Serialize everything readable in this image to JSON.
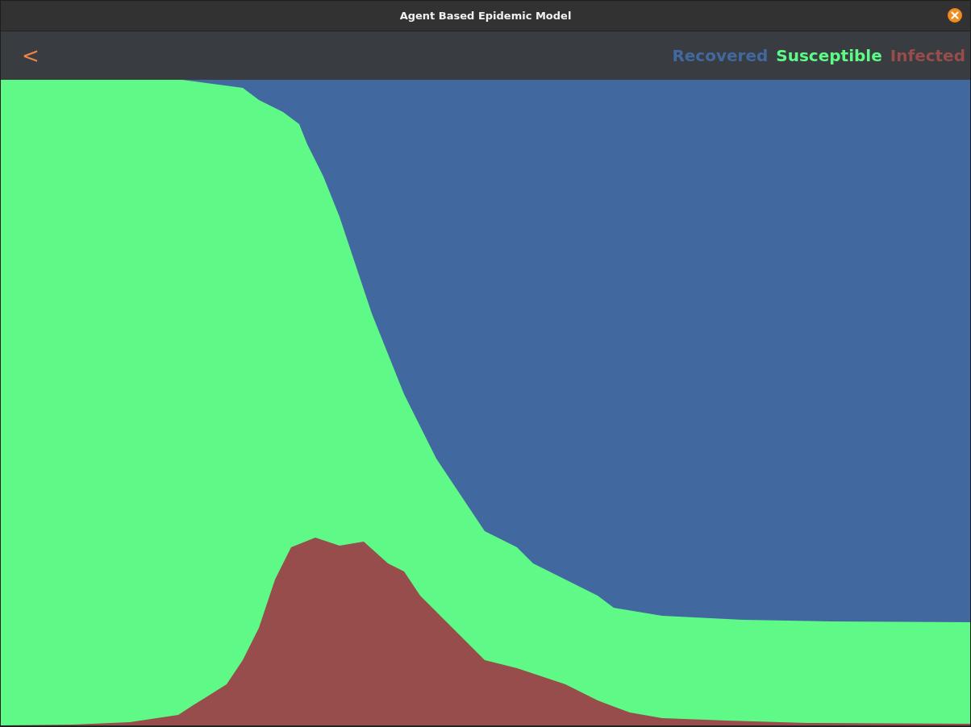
{
  "window": {
    "title": "Agent Based Epidemic Model"
  },
  "toolbar": {
    "back_button": "<"
  },
  "legend": [
    {
      "label": "Recovered",
      "color": "#4169a0"
    },
    {
      "label": "Susceptible",
      "color": "#5ff987"
    },
    {
      "label": "Infected",
      "color": "#964d4b"
    }
  ]
}
